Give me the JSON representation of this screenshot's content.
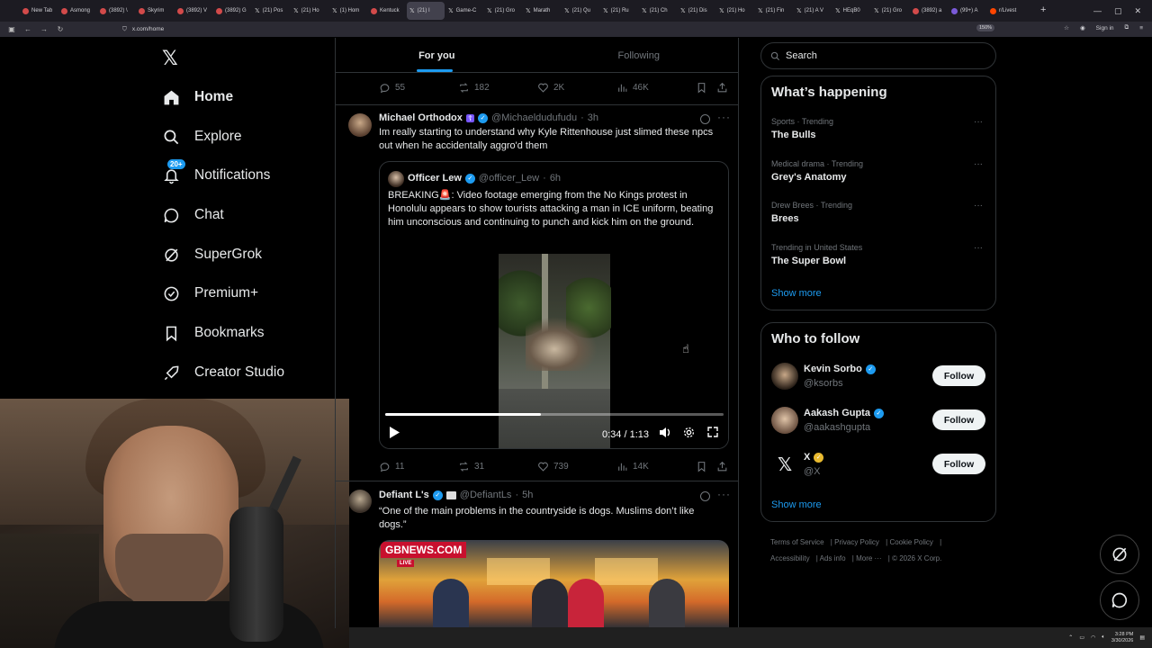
{
  "browser": {
    "tabs": [
      {
        "label": "New Tab",
        "icon": "globe-icon"
      },
      {
        "label": "Asmong",
        "icon": "twitch-icon"
      },
      {
        "label": "(3892) \\",
        "icon": "youtube-icon"
      },
      {
        "label": "Skyrim",
        "icon": "youtube-icon"
      },
      {
        "label": "(3892) V",
        "icon": "youtube-icon"
      },
      {
        "label": "(3892) G",
        "icon": "youtube-icon"
      },
      {
        "label": "(21) Pos",
        "icon": "x-icon"
      },
      {
        "label": "(21) Ho",
        "icon": "x-icon"
      },
      {
        "label": "(1) Hom",
        "icon": "x-icon"
      },
      {
        "label": "Kentuck",
        "icon": "youtube-icon"
      },
      {
        "label": "(21) I",
        "icon": "x-icon",
        "active": true
      },
      {
        "label": "Game-C",
        "icon": "x-icon"
      },
      {
        "label": "(21) Gro",
        "icon": "x-icon"
      },
      {
        "label": "Marath",
        "icon": "x-icon"
      },
      {
        "label": "(21) Qu",
        "icon": "x-icon"
      },
      {
        "label": "(21) Ru",
        "icon": "x-icon"
      },
      {
        "label": "(21) Ch",
        "icon": "x-icon"
      },
      {
        "label": "(21) Dis",
        "icon": "x-icon"
      },
      {
        "label": "(21) Ho",
        "icon": "x-icon"
      },
      {
        "label": "(21) Fin",
        "icon": "x-icon"
      },
      {
        "label": "(21) A V",
        "icon": "x-icon"
      },
      {
        "label": "HEqB0",
        "icon": "x-icon"
      },
      {
        "label": "(21) Gro",
        "icon": "x-icon"
      },
      {
        "label": "(3892) a",
        "icon": "youtube-icon"
      },
      {
        "label": "(99+) A",
        "icon": "github-icon"
      },
      {
        "label": "r/Livest",
        "icon": "reddit-icon"
      }
    ],
    "url": "x.com/home",
    "zoom": "150%",
    "sign_in": "Sign in"
  },
  "sidebar": {
    "items": [
      {
        "label": "Home",
        "icon": "home-icon",
        "active": true
      },
      {
        "label": "Explore",
        "icon": "search-icon"
      },
      {
        "label": "Notifications",
        "icon": "bell-icon",
        "badge": "20+"
      },
      {
        "label": "Chat",
        "icon": "chat-icon"
      },
      {
        "label": "SuperGrok",
        "icon": "grok-icon"
      },
      {
        "label": "Premium+",
        "icon": "premium-icon"
      },
      {
        "label": "Bookmarks",
        "icon": "bookmark-icon"
      },
      {
        "label": "Creator Studio",
        "icon": "rocket-icon"
      }
    ]
  },
  "feed": {
    "tabs": [
      "For you",
      "Following"
    ],
    "prev_tweet_actions": {
      "replies": "55",
      "reposts": "182",
      "likes": "2K",
      "views": "46K"
    },
    "tweet1": {
      "name": "Michael Orthodox",
      "handle": "@Michaeldudufudu",
      "time": "3h",
      "text": "Im really starting to understand why Kyle Rittenhouse just slimed these npcs out when he accidentally aggro'd them",
      "quote": {
        "name": "Officer Lew",
        "handle": "@officer_Lew",
        "time": "6h",
        "text": "BREAKING🚨: Video footage emerging from the No Kings protest in Honolulu appears to show tourists attacking a man in ICE uniform, beating him unconscious and continuing to punch and kick him on the ground.",
        "video_time": "0:34 / 1:13",
        "progress": 0.46
      },
      "actions": {
        "replies": "11",
        "reposts": "31",
        "likes": "739",
        "views": "14K"
      }
    },
    "tweet2": {
      "name": "Defiant L's",
      "handle": "@DefiantLs",
      "time": "5h",
      "text": "“One of the main problems in the countryside is dogs. Muslims don’t like dogs.”",
      "image_logo": "GBNEWS.COM",
      "image_live": "LIVE"
    }
  },
  "right": {
    "search_placeholder": "Search",
    "happening_title": "What’s happening",
    "trends": [
      {
        "meta": "Sports · Trending",
        "name": "The Bulls"
      },
      {
        "meta": "Medical drama · Trending",
        "name": "Grey's Anatomy"
      },
      {
        "meta": "Drew Brees · Trending",
        "name": "Brees"
      },
      {
        "meta": "Trending in United States",
        "name": "The Super Bowl"
      }
    ],
    "show_more": "Show more",
    "wtf_title": "Who to follow",
    "wtf": [
      {
        "name": "Kevin Sorbo",
        "handle": "@ksorbs"
      },
      {
        "name": "Aakash Gupta",
        "handle": "@aakashgupta"
      },
      {
        "name": "X",
        "handle": "@X"
      }
    ],
    "follow_label": "Follow",
    "footer": [
      "Terms of Service",
      "Privacy Policy",
      "Cookie Policy",
      "Accessibility",
      "Ads info",
      "More ···",
      "© 2026 X Corp."
    ]
  },
  "taskbar": {
    "time": "3:28 PM",
    "date": "3/30/2026"
  },
  "colors": {
    "accent": "#1d9bf0",
    "background": "#000000",
    "border": "#2f3336",
    "muted": "#71767b"
  }
}
